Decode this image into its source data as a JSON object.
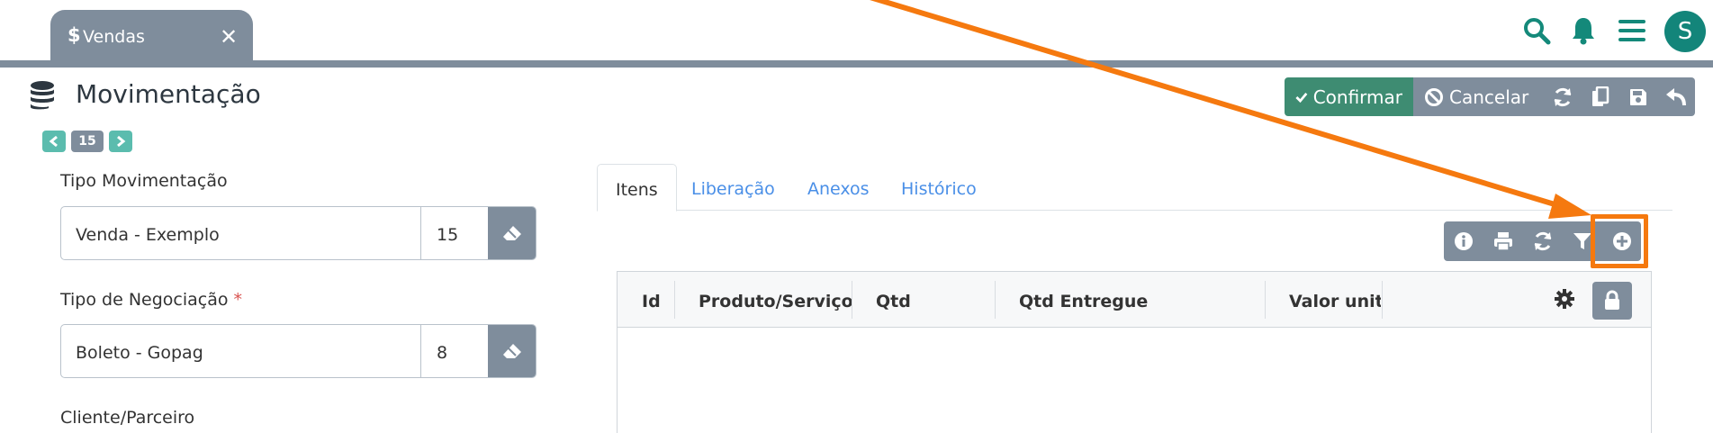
{
  "tab": {
    "icon": "dollar-icon",
    "label": "Vendas",
    "close_icon": "close-icon"
  },
  "topbar": {
    "icons": [
      "search-icon",
      "bell-icon",
      "menu-icon"
    ],
    "avatar_letter": "S",
    "accent": "#14897a"
  },
  "page": {
    "icon": "coins-stack-icon",
    "title": "Movimentação",
    "record_number": "15"
  },
  "actions": {
    "confirm_label": "Confirmar",
    "cancel_label": "Cancelar",
    "icons": [
      "refresh-icon",
      "copy-icon",
      "save-icon",
      "undo-icon"
    ]
  },
  "form": {
    "tipo_movimentacao": {
      "label": "Tipo Movimentação",
      "value": "Venda - Exemplo",
      "code": "15"
    },
    "tipo_negociacao": {
      "label": "Tipo de Negociação",
      "required_mark": "*",
      "value": "Boleto - Gopag",
      "code": "8"
    },
    "cliente": {
      "label": "Cliente/Parceiro"
    }
  },
  "tabs": [
    {
      "label": "Itens",
      "active": true
    },
    {
      "label": "Liberação",
      "active": false
    },
    {
      "label": "Anexos",
      "active": false
    },
    {
      "label": "Histórico",
      "active": false
    }
  ],
  "grid_toolbar": {
    "icons": [
      "info-icon",
      "print-icon",
      "refresh-icon",
      "filter-icon",
      "add-icon"
    ]
  },
  "grid": {
    "columns": [
      "Id",
      "Produto/Serviço",
      "Qtd",
      "Qtd Entregue",
      "Valor unitár"
    ],
    "rows": []
  },
  "annotation": {
    "color": "#f5790f"
  }
}
